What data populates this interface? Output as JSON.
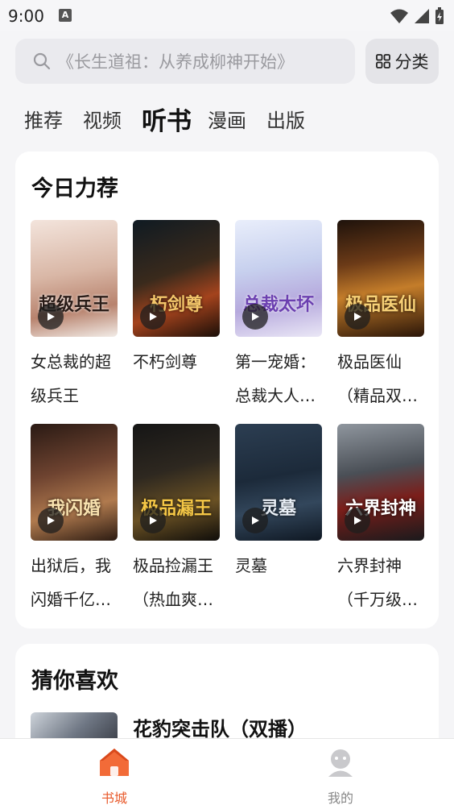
{
  "status_bar": {
    "time": "9:00",
    "notification_icon": "A"
  },
  "search": {
    "placeholder": "《长生道祖：从养成柳神开始》"
  },
  "category_button": {
    "label": "分类"
  },
  "tabs": [
    {
      "label": "推荐",
      "active": false
    },
    {
      "label": "视频",
      "active": false
    },
    {
      "label": "听书",
      "active": true
    },
    {
      "label": "漫画",
      "active": false
    },
    {
      "label": "出版",
      "active": false
    }
  ],
  "recommend": {
    "title": "今日力荐",
    "books": [
      {
        "title": "女总裁的超级兵王",
        "cover_text": "超级兵王"
      },
      {
        "title": "不朽剑尊",
        "cover_text": "朽剑尊"
      },
      {
        "title": "第一宠婚：总裁大人太坏了",
        "cover_text": "总裁太坏"
      },
      {
        "title": "极品医仙（精品双播）",
        "cover_text": "极品医仙"
      },
      {
        "title": "出狱后，我闪婚千亿老公",
        "cover_text": "我闪婚"
      },
      {
        "title": "极品捡漏王（热血爽文）",
        "cover_text": "极品漏王"
      },
      {
        "title": "灵墓",
        "cover_text": "灵墓"
      },
      {
        "title": "六界封神（千万级爆款）",
        "cover_text": "六界封神"
      }
    ]
  },
  "guess": {
    "title": "猜你喜欢",
    "first_book": {
      "title": "花豹突击队（双播）"
    }
  },
  "bottom_nav": [
    {
      "label": "书城",
      "icon": "home-icon",
      "active": true
    },
    {
      "label": "我的",
      "icon": "user-icon",
      "active": false
    }
  ],
  "colors": {
    "accent": "#e8592a",
    "inactive": "#888888"
  }
}
